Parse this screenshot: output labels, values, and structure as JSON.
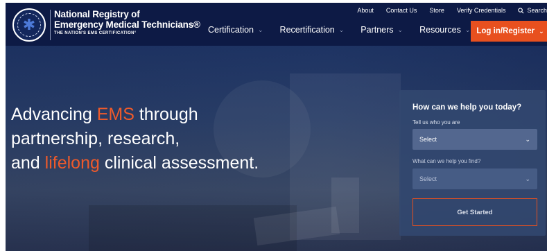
{
  "header": {
    "logo": {
      "line1": "National Registry of",
      "line2": "Emergency Medical Technicians®",
      "tagline": "THE NATION'S EMS CERTIFICATION°"
    },
    "top_links": [
      "About",
      "Contact Us",
      "Store",
      "Verify Credentials"
    ],
    "search_label": "Search",
    "nav": [
      "Certification",
      "Recertification",
      "Partners",
      "Resources"
    ],
    "login_label": "Log in/Register"
  },
  "hero": {
    "line1_before": "Advancing ",
    "line1_accent": "EMS",
    "line1_after": " through",
    "line2": "partnership, research,",
    "line3_before": "and ",
    "line3_accent": "lifelong",
    "line3_after": " clinical assessment."
  },
  "help": {
    "title": "How can we help you today?",
    "who_label": "Tell us who you are",
    "who_value": "Select",
    "find_label": "What can we help you find?",
    "find_value": "Select",
    "cta": "Get Started"
  },
  "colors": {
    "navy": "#0d1a45",
    "accent": "#e8501f"
  },
  "icons": [
    "star-of-life-icon",
    "search-icon",
    "chevron-down-icon"
  ]
}
